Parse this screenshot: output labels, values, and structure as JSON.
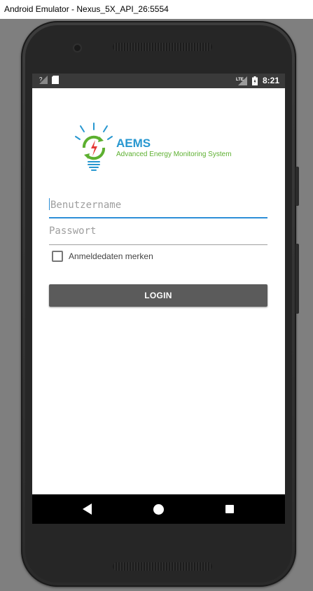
{
  "window": {
    "title": "Android Emulator - Nexus_5X_API_26:5554"
  },
  "statusbar": {
    "time": "8:21",
    "network": "LTE"
  },
  "logo": {
    "name": "AEMS",
    "tagline": "Advanced Energy Monitoring System",
    "colors": {
      "blue": "#2797d0",
      "green": "#5db030",
      "red": "#e53935"
    }
  },
  "form": {
    "username_placeholder": "Benutzername",
    "password_placeholder": "Passwort",
    "remember_label": "Anmeldedaten merken",
    "remember_checked": false,
    "login_label": "LOGIN"
  },
  "colors": {
    "accent": "#2d8fd7",
    "button": "#5b5b5b"
  }
}
